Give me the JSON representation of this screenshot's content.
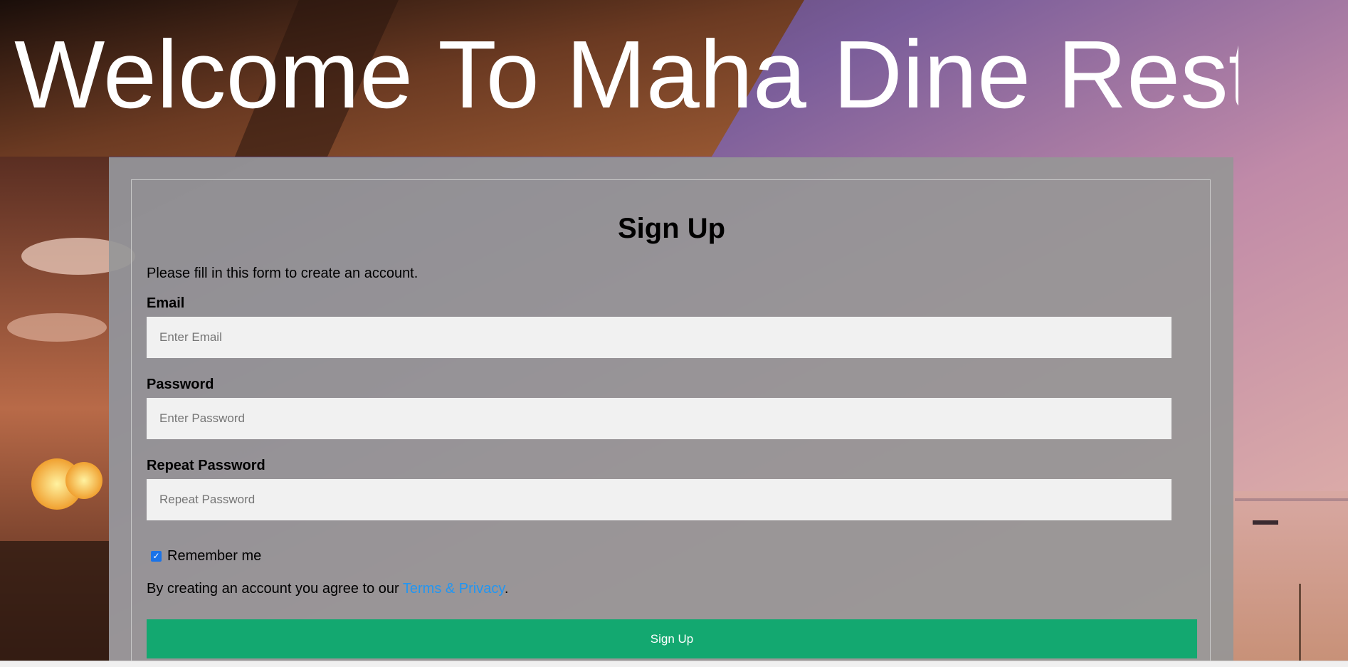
{
  "hero": {
    "title": "Welcome To Maha Dine Restaurant"
  },
  "form": {
    "title": "Sign Up",
    "intro": "Please fill in this form to create an account.",
    "email": {
      "label": "Email",
      "placeholder": "Enter Email",
      "value": ""
    },
    "password": {
      "label": "Password",
      "placeholder": "Enter Password",
      "value": ""
    },
    "repeat_password": {
      "label": "Repeat Password",
      "placeholder": "Repeat Password",
      "value": ""
    },
    "remember": {
      "label": "Remember me",
      "checked": true
    },
    "terms": {
      "prefix": "By creating an account you agree to our ",
      "link_text": "Terms & Privacy",
      "suffix": "."
    },
    "submit_label": "Sign Up"
  },
  "colors": {
    "accent": "#13a870",
    "link": "#2196f3",
    "panel": "#9a9a9a",
    "input_bg": "#f1f1f1"
  }
}
